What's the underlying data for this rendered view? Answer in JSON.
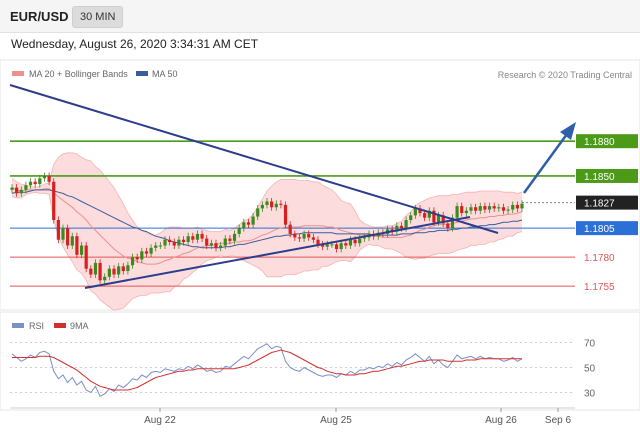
{
  "header": {
    "symbol": "EUR/USD",
    "timeframe": "30 MIN",
    "datetime": "Wednesday, August 26, 2020 3:34:31 AM CET"
  },
  "colors": {
    "ma20_bands": "#f08f8f",
    "band_fill": "#fbd6d6",
    "ma50": "#3a5b9c",
    "resistance": "#4d9a19",
    "support_red": "#e05555",
    "support_blue": "#2c6fd6",
    "current": "#222222",
    "trendline": "#2d3d8b",
    "arrow": "#2e5fa8",
    "candle_up": "#3c8a1f",
    "candle_down": "#d62020",
    "rsi": "#7b8fc8",
    "rsi_ma": "#d03030"
  },
  "main_legend": [
    {
      "label": "MA 20 + Bollinger Bands",
      "color": "#f08f8f"
    },
    {
      "label": "MA 50",
      "color": "#3a5b9c"
    }
  ],
  "copyright": "Research © 2020 Trading Central",
  "rsi_legend": [
    {
      "label": "RSI",
      "color": "#7b8fc8"
    },
    {
      "label": "9MA",
      "color": "#d03030"
    }
  ],
  "chart_data": [
    {
      "type": "candlestick",
      "ylim": [
        1.1743,
        1.19
      ],
      "x_ticks": [
        "Aug 22",
        "Aug 25",
        "Aug 26",
        "Sep 6"
      ],
      "levels": [
        {
          "label": "1.1880",
          "value": 1.188,
          "kind": "resistance"
        },
        {
          "label": "1.1850",
          "value": 1.185,
          "kind": "resistance"
        },
        {
          "label": "1.1827",
          "value": 1.1827,
          "kind": "current"
        },
        {
          "label": "1.1805",
          "value": 1.1805,
          "kind": "support_blue"
        },
        {
          "label": "1.1780",
          "value": 1.178,
          "kind": "support_red"
        },
        {
          "label": "1.1755",
          "value": 1.1755,
          "kind": "support_red"
        }
      ],
      "close": [
        1.184,
        1.1835,
        1.1838,
        1.1842,
        1.1845,
        1.1843,
        1.1848,
        1.185,
        1.1845,
        1.1812,
        1.1795,
        1.1805,
        1.179,
        1.1798,
        1.1782,
        1.179,
        1.177,
        1.1765,
        1.1775,
        1.176,
        1.1763,
        1.177,
        1.1765,
        1.1772,
        1.1768,
        1.1773,
        1.178,
        1.1778,
        1.1785,
        1.1783,
        1.1788,
        1.179,
        1.179,
        1.1795,
        1.1793,
        1.179,
        1.1795,
        1.1793,
        1.1798,
        1.1795,
        1.18,
        1.1796,
        1.179,
        1.1792,
        1.1788,
        1.179,
        1.1796,
        1.1794,
        1.18,
        1.1805,
        1.181,
        1.1808,
        1.1815,
        1.1822,
        1.1825,
        1.1828,
        1.1823,
        1.1826,
        1.1825,
        1.1808,
        1.18,
        1.1797,
        1.1796,
        1.18,
        1.1797,
        1.1795,
        1.1791,
        1.1789,
        1.1791,
        1.1791,
        1.1787,
        1.1792,
        1.179,
        1.1795,
        1.1792,
        1.1796,
        1.1797,
        1.18,
        1.1798,
        1.1801,
        1.18,
        1.1804,
        1.1802,
        1.1807,
        1.1805,
        1.1812,
        1.1816,
        1.1822,
        1.1818,
        1.1814,
        1.182,
        1.181,
        1.1816,
        1.1809,
        1.1805,
        1.1814,
        1.1824,
        1.1818,
        1.182,
        1.1823,
        1.182,
        1.1824,
        1.1821,
        1.1824,
        1.1822,
        1.1823,
        1.182,
        1.1821,
        1.1825,
        1.1822,
        1.1826
      ],
      "ma20": [
        1.184,
        1.1838,
        1.1837,
        1.1838,
        1.1838,
        1.1838,
        1.1838,
        1.1839,
        1.1839,
        1.1836,
        1.1832,
        1.1829,
        1.1826,
        1.1823,
        1.1819,
        1.1816,
        1.1812,
        1.1807,
        1.1803,
        1.1799,
        1.1795,
        1.1791,
        1.1787,
        1.1784,
        1.1781,
        1.1779,
        1.1778,
        1.1776,
        1.1775,
        1.1774,
        1.1774,
        1.1774,
        1.1775,
        1.1777,
        1.1778,
        1.178,
        1.1781,
        1.1783,
        1.1784,
        1.1786,
        1.1788,
        1.1789,
        1.179,
        1.179,
        1.1791,
        1.1792,
        1.1792,
        1.1792,
        1.1793,
        1.1793,
        1.1794,
        1.1794,
        1.1795,
        1.1797,
        1.1799,
        1.18,
        1.1802,
        1.1804,
        1.1805,
        1.1806,
        1.1806,
        1.1806,
        1.1806,
        1.1807,
        1.1807,
        1.1807,
        1.1807,
        1.1807,
        1.1806,
        1.1806,
        1.1805,
        1.1803,
        1.1802,
        1.1801,
        1.18,
        1.1799,
        1.1799,
        1.1799,
        1.1798,
        1.1798,
        1.1797,
        1.1797,
        1.1797,
        1.1797,
        1.1797,
        1.1798,
        1.1799,
        1.1801,
        1.1803,
        1.1804,
        1.1806,
        1.1807,
        1.1808,
        1.1808,
        1.1808,
        1.1809,
        1.181,
        1.1811,
        1.1812,
        1.1813,
        1.1813,
        1.1814,
        1.1814,
        1.1815,
        1.1815,
        1.1816,
        1.1816,
        1.1817,
        1.1817,
        1.1818,
        1.1819
      ],
      "upper_band": [
        1.1848,
        1.1845,
        1.1843,
        1.1842,
        1.1841,
        1.184,
        1.1841,
        1.1843,
        1.1844,
        1.186,
        1.1866,
        1.1869,
        1.187,
        1.187,
        1.1869,
        1.1866,
        1.1864,
        1.1863,
        1.1858,
        1.1855,
        1.185,
        1.1845,
        1.184,
        1.1833,
        1.1826,
        1.1818,
        1.1812,
        1.1806,
        1.1803,
        1.1801,
        1.1799,
        1.1799,
        1.1801,
        1.1804,
        1.1806,
        1.1806,
        1.1806,
        1.1805,
        1.1805,
        1.1805,
        1.1806,
        1.1804,
        1.1803,
        1.1802,
        1.1802,
        1.1802,
        1.1804,
        1.1803,
        1.1805,
        1.1808,
        1.1811,
        1.1813,
        1.1817,
        1.1823,
        1.183,
        1.1837,
        1.1841,
        1.1845,
        1.1847,
        1.1847,
        1.1847,
        1.1847,
        1.1846,
        1.1846,
        1.1846,
        1.1845,
        1.1845,
        1.1842,
        1.184,
        1.1838,
        1.1834,
        1.1829,
        1.1827,
        1.1826,
        1.182,
        1.1812,
        1.1809,
        1.1807,
        1.1806,
        1.1806,
        1.1806,
        1.1807,
        1.1807,
        1.1809,
        1.1811,
        1.1816,
        1.1819,
        1.1824,
        1.1827,
        1.1829,
        1.1831,
        1.1832,
        1.1833,
        1.1833,
        1.1833,
        1.1834,
        1.1834,
        1.1835,
        1.1836,
        1.1836,
        1.1836,
        1.1837,
        1.1837,
        1.1837,
        1.1837,
        1.1837,
        1.1836,
        1.1836,
        1.1836,
        1.1835,
        1.1836
      ],
      "lower_band": [
        1.1832,
        1.1831,
        1.1831,
        1.1834,
        1.1835,
        1.1836,
        1.1835,
        1.1835,
        1.1834,
        1.1812,
        1.1798,
        1.1789,
        1.1782,
        1.1776,
        1.1769,
        1.1766,
        1.176,
        1.1751,
        1.1748,
        1.1743,
        1.174,
        1.1737,
        1.1734,
        1.1735,
        1.1736,
        1.174,
        1.1744,
        1.1746,
        1.1747,
        1.1747,
        1.1749,
        1.1749,
        1.1749,
        1.175,
        1.175,
        1.1754,
        1.1756,
        1.1761,
        1.1763,
        1.1767,
        1.177,
        1.1774,
        1.1777,
        1.1778,
        1.178,
        1.1782,
        1.178,
        1.1781,
        1.1781,
        1.1778,
        1.1777,
        1.1775,
        1.1773,
        1.1771,
        1.1768,
        1.1763,
        1.1763,
        1.1763,
        1.1763,
        1.1765,
        1.1765,
        1.1765,
        1.1766,
        1.1768,
        1.1768,
        1.1769,
        1.1769,
        1.1772,
        1.1772,
        1.1774,
        1.1776,
        1.1777,
        1.1777,
        1.1776,
        1.178,
        1.1786,
        1.1789,
        1.1791,
        1.179,
        1.179,
        1.1788,
        1.1787,
        1.1787,
        1.1785,
        1.1783,
        1.178,
        1.1779,
        1.1778,
        1.1779,
        1.1779,
        1.1781,
        1.1782,
        1.1783,
        1.1783,
        1.1783,
        1.1784,
        1.1786,
        1.1787,
        1.1788,
        1.179,
        1.179,
        1.1791,
        1.1791,
        1.1793,
        1.1793,
        1.1795,
        1.1796,
        1.1798,
        1.1798,
        1.1801,
        1.1802
      ],
      "ma50": [
        1.1835,
        1.1836,
        1.1836,
        1.1836,
        1.1837,
        1.1838,
        1.1838,
        1.1838,
        1.1838,
        1.1837,
        1.1836,
        1.1835,
        1.1833,
        1.1832,
        1.183,
        1.1828,
        1.1826,
        1.1824,
        1.1822,
        1.182,
        1.1818,
        1.1816,
        1.1814,
        1.1812,
        1.181,
        1.1808,
        1.1806,
        1.1805,
        1.1803,
        1.1802,
        1.18,
        1.1798,
        1.1797,
        1.1796,
        1.1794,
        1.1793,
        1.1792,
        1.1791,
        1.179,
        1.1789,
        1.1789,
        1.1788,
        1.1788,
        1.1788,
        1.1788,
        1.1788,
        1.1789,
        1.1789,
        1.179,
        1.1791,
        1.1791,
        1.1792,
        1.1793,
        1.1794,
        1.1795,
        1.1796,
        1.1797,
        1.1798,
        1.1798,
        1.1799,
        1.1799,
        1.18,
        1.18,
        1.1801,
        1.1801,
        1.1801,
        1.1801,
        1.1801,
        1.1801,
        1.1801,
        1.18,
        1.18,
        1.18,
        1.18,
        1.18,
        1.18,
        1.18,
        1.18,
        1.1799,
        1.1799,
        1.1799,
        1.1799,
        1.1799,
        1.1799,
        1.18,
        1.18,
        1.18,
        1.1801,
        1.1801,
        1.1801,
        1.1802,
        1.1802,
        1.1803,
        1.1803,
        1.1803,
        1.1804,
        1.1804,
        1.1805,
        1.1805,
        1.1806,
        1.1806,
        1.1807,
        1.1807,
        1.1808,
        1.1808,
        1.1809,
        1.181,
        1.181,
        1.1811,
        1.1811,
        1.1812
      ]
    },
    {
      "type": "line",
      "name": "RSI",
      "ylim": [
        20,
        80
      ],
      "y_ticks": [
        70,
        50,
        30
      ],
      "x_ticks": [
        "Aug 22",
        "Aug 25",
        "Aug 26",
        "Sep 6"
      ],
      "series": [
        {
          "name": "RSI",
          "values": [
            61,
            58,
            55,
            57,
            60,
            58,
            62,
            63,
            61,
            47,
            41,
            44,
            38,
            42,
            36,
            39,
            32,
            30,
            35,
            27,
            29,
            33,
            31,
            36,
            34,
            37,
            41,
            40,
            44,
            42,
            46,
            47,
            46,
            49,
            48,
            47,
            49,
            48,
            51,
            49,
            52,
            50,
            47,
            48,
            46,
            47,
            51,
            50,
            53,
            56,
            59,
            57,
            61,
            65,
            67,
            69,
            65,
            67,
            66,
            55,
            50,
            48,
            47,
            50,
            48,
            46,
            44,
            43,
            44,
            44,
            42,
            45,
            44,
            47,
            45,
            48,
            48,
            50,
            49,
            51,
            50,
            53,
            51,
            54,
            52,
            56,
            58,
            61,
            58,
            55,
            59,
            53,
            56,
            52,
            50,
            55,
            60,
            57,
            58,
            59,
            57,
            59,
            57,
            58,
            57,
            57,
            55,
            56,
            58,
            55,
            57
          ]
        },
        {
          "name": "9MA",
          "values": [
            58,
            58,
            58,
            58,
            58,
            58,
            59,
            59,
            59,
            58,
            56,
            54,
            52,
            50,
            48,
            45,
            42,
            39,
            37,
            35,
            34,
            33,
            32,
            32,
            32,
            32,
            33,
            34,
            36,
            38,
            40,
            42,
            43,
            44,
            45,
            46,
            47,
            47,
            48,
            48,
            49,
            49,
            49,
            49,
            49,
            49,
            49,
            49,
            49,
            50,
            51,
            52,
            54,
            56,
            58,
            60,
            62,
            63,
            64,
            63,
            62,
            60,
            58,
            56,
            54,
            52,
            50,
            49,
            47,
            46,
            45,
            45,
            44,
            44,
            44,
            45,
            45,
            46,
            47,
            47,
            48,
            49,
            50,
            51,
            51,
            52,
            53,
            54,
            55,
            55,
            56,
            56,
            56,
            56,
            55,
            55,
            55,
            55,
            56,
            56,
            56,
            57,
            57,
            57,
            57,
            57,
            57,
            57,
            57,
            57,
            57
          ]
        }
      ]
    }
  ]
}
